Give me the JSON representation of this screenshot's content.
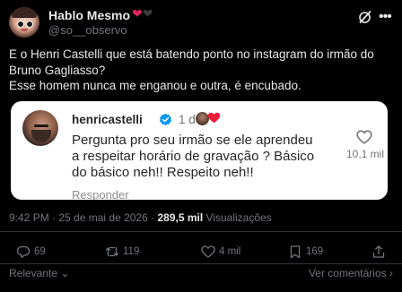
{
  "author": {
    "display_name": "Hablo Mesmo",
    "name_emojis": [
      "red-heart",
      "black-heart"
    ],
    "handle": "@so__observo",
    "avatar": "cartoon-face-avatar"
  },
  "header_icons": [
    "grok-icon",
    "more-icon"
  ],
  "tweet": {
    "lines": [
      "E o Henri Castelli que está batendo ponto no instagram do irmão do",
      "Bruno Gagliasso?",
      "Esse homem nunca me enganou e outra, é encubado."
    ]
  },
  "embedded_comment": {
    "username": "henricastelli",
    "verified": true,
    "time": "1 d",
    "comment_lines": [
      "Pergunta pro seu irmão  se ele aprendeu",
      "a respeitar horário de gravação ? Básico",
      "do básico neh!! Respeito neh!!"
    ],
    "reply_label": "Responder",
    "like_count": "10,1 mil"
  },
  "meta": {
    "time": "9:42 PM",
    "separator": " · ",
    "date": "25 de mai de 2026",
    "views_count": "289,5 mil",
    "views_label": "Visualizações"
  },
  "actions": {
    "replies": "69",
    "retweets": "119",
    "likes": "4 mil",
    "bookmarks": "169"
  },
  "bottom_bar": {
    "sort_label": "Relevante",
    "view_replies_label": "Ver comentários"
  },
  "colors": {
    "background": "#000000",
    "text_primary": "#e7e9ea",
    "text_secondary": "#71767b",
    "divider": "#2f3336",
    "verified_blue": "#0095f6",
    "heart_red": "#e0245e"
  }
}
